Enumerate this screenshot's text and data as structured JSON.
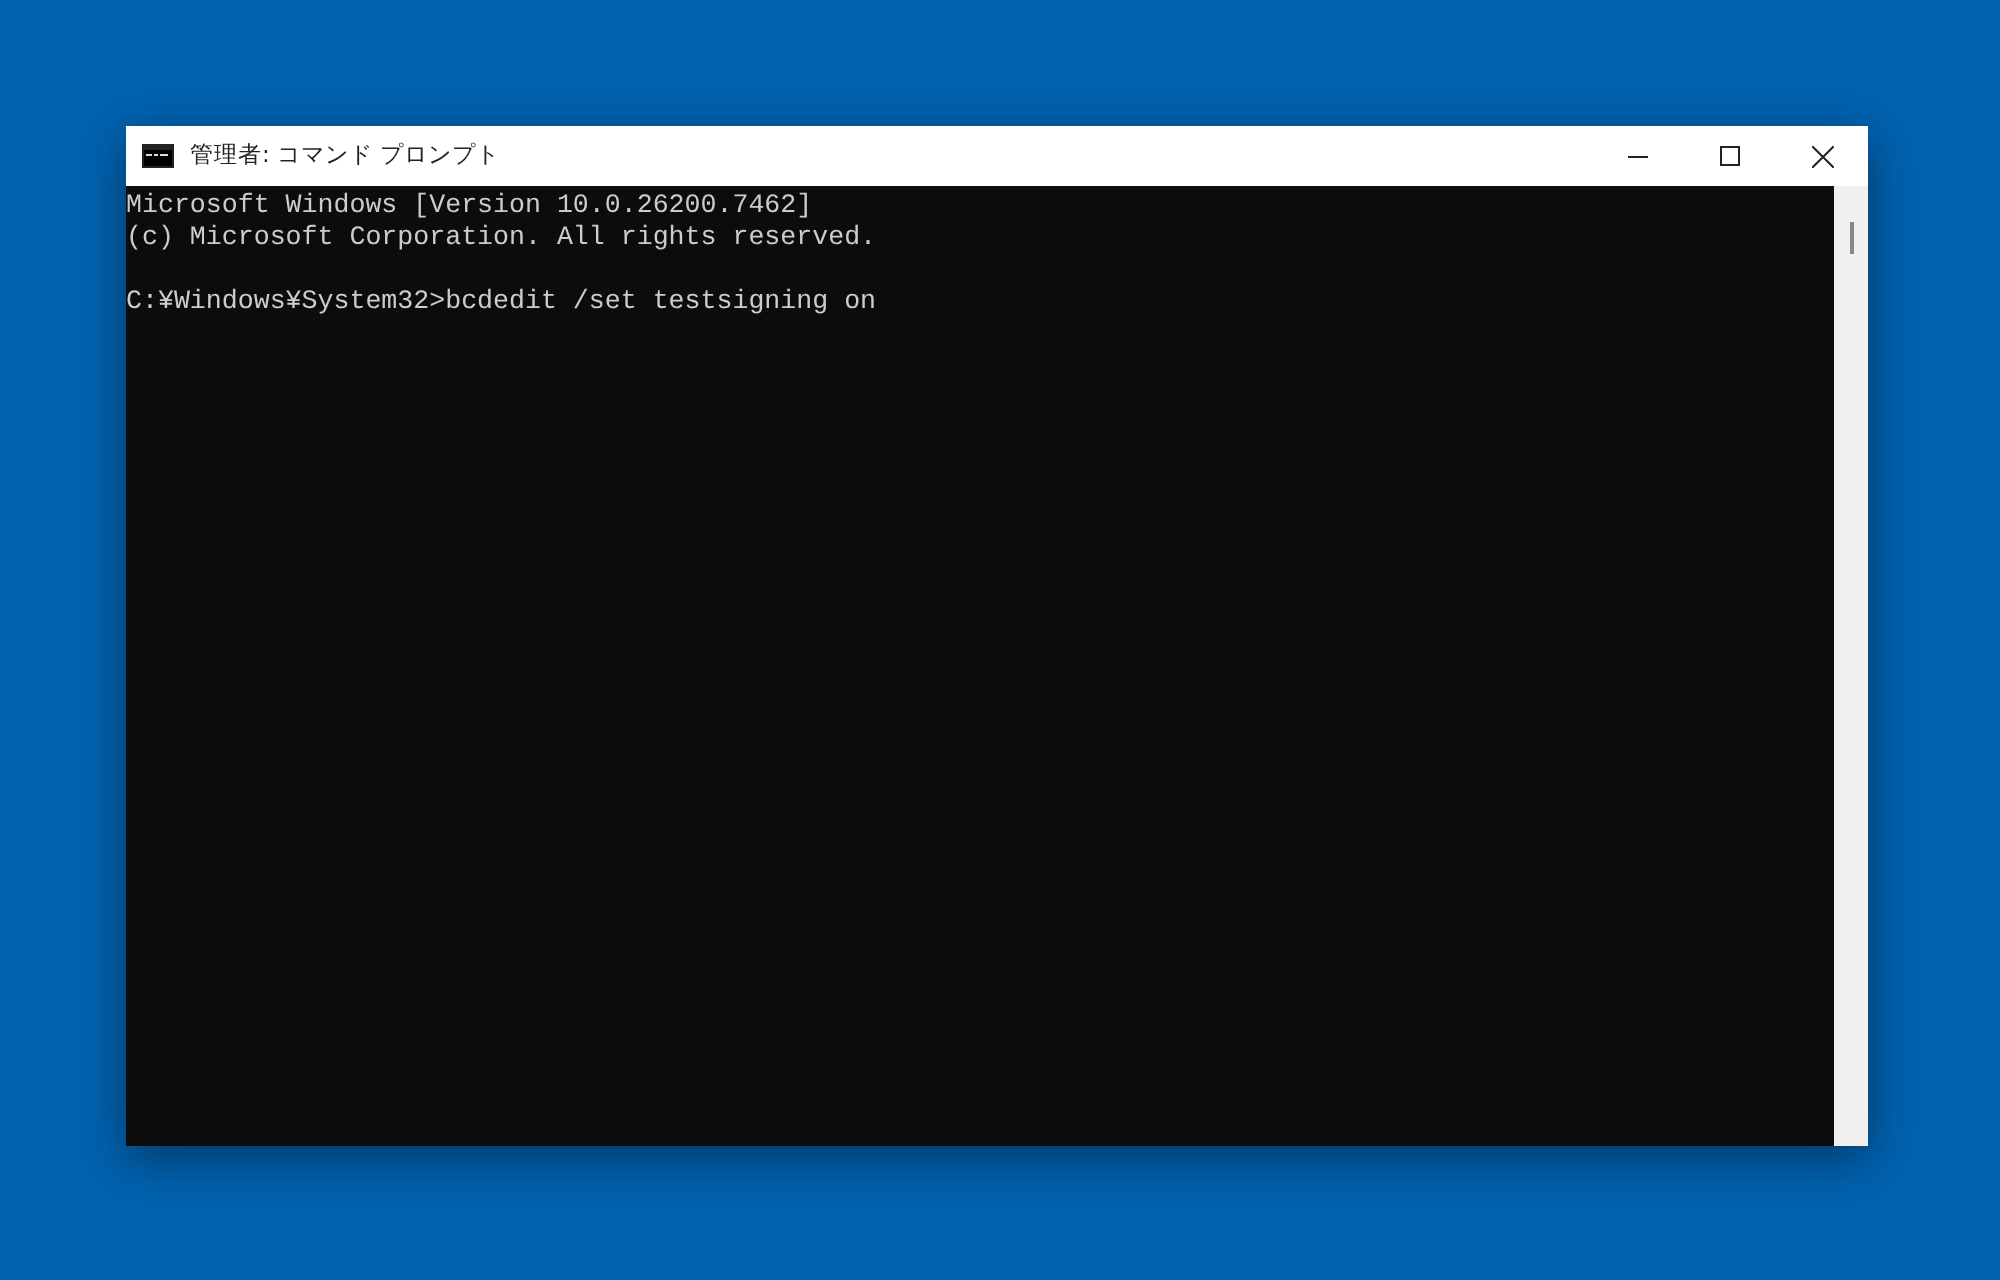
{
  "window": {
    "title": "管理者: コマンド プロンプト"
  },
  "console": {
    "blocks": [
      {
        "lines": [
          "Microsoft Windows [Version 10.0.26200.7462]",
          "(c) Microsoft Corporation. All rights reserved."
        ]
      },
      {
        "lines": [
          "C:¥Windows¥System32>bcdedit /set testsigning on"
        ]
      }
    ]
  }
}
